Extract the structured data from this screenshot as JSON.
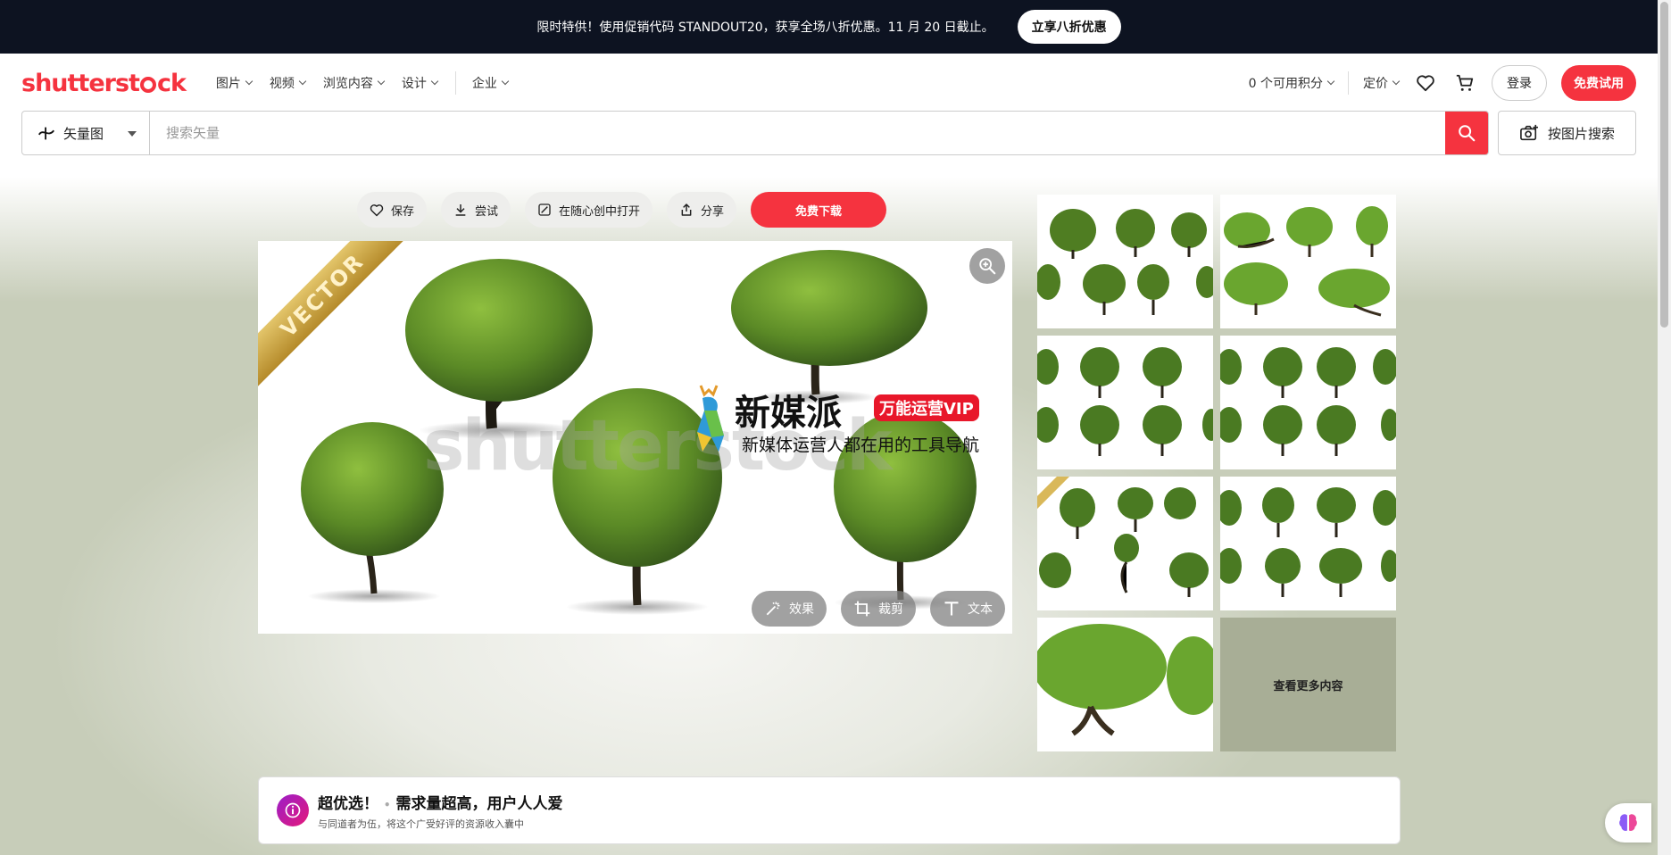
{
  "promo": {
    "text": "限时特供！使用促销代码 STANDOUT20，获享全场八折优惠。11 月 20 日截止。",
    "button": "立享八折优惠"
  },
  "header": {
    "logo": {
      "before": "shutterst",
      "after": "ck"
    },
    "nav": [
      "图片",
      "视频",
      "浏览内容",
      "设计",
      "企业"
    ],
    "credits": "0 个可用积分",
    "pricing": "定价",
    "login": "登录",
    "trial": "免费试用"
  },
  "search": {
    "type": "矢量图",
    "placeholder": "搜索矢量",
    "image_search": "按图片搜索"
  },
  "actions": {
    "save": "保存",
    "try": "尝试",
    "open_in": "在随心创中打开",
    "share": "分享",
    "download": "免费下载"
  },
  "preview": {
    "ribbon": "VECTOR",
    "watermark": "shutterstock",
    "overlay_title": "新媒派",
    "overlay_tag": "万能运营VIP",
    "overlay_subtitle": "新媒体运营人都在用的工具导航",
    "tools": {
      "effects": "效果",
      "crop": "裁剪",
      "text": "文本"
    }
  },
  "thumbnails": {
    "more": "查看更多内容"
  },
  "pick": {
    "title": "超优选！",
    "headline": "需求量超高，用户人人爱",
    "subtitle": "与同道者为伍，将这个广受好评的资源收入囊中"
  },
  "colors": {
    "brand": "#f5333f",
    "banner": "#0d1321",
    "tree": "#5b8a26"
  }
}
